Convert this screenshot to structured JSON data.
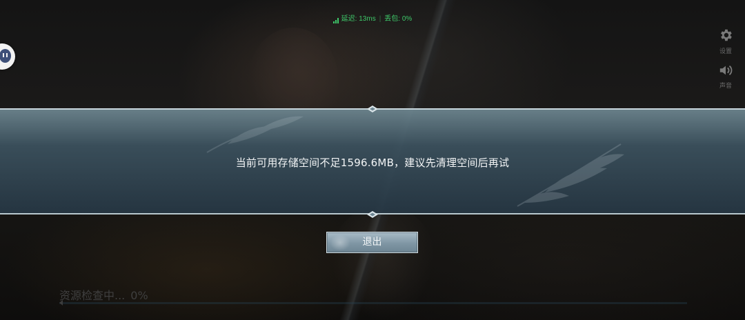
{
  "status_bar": {
    "latency_label": "延迟:",
    "latency_value": "13ms",
    "packet_loss_label": "丢包:",
    "packet_loss_value": "0%",
    "color": "#3ec96a"
  },
  "side_buttons": {
    "settings_label": "设置",
    "sound_label": "声音"
  },
  "dialog": {
    "message": "当前可用存储空间不足1596.6MB，建议先清理空间后再试",
    "exit_label": "退出"
  },
  "loading": {
    "text": "资源检查中...",
    "percent_text": "0%",
    "progress": 0
  },
  "icons": {
    "chat": "chat-bubble-icon",
    "settings": "gear-icon",
    "sound": "speaker-icon",
    "signal": "signal-bars-icon"
  }
}
